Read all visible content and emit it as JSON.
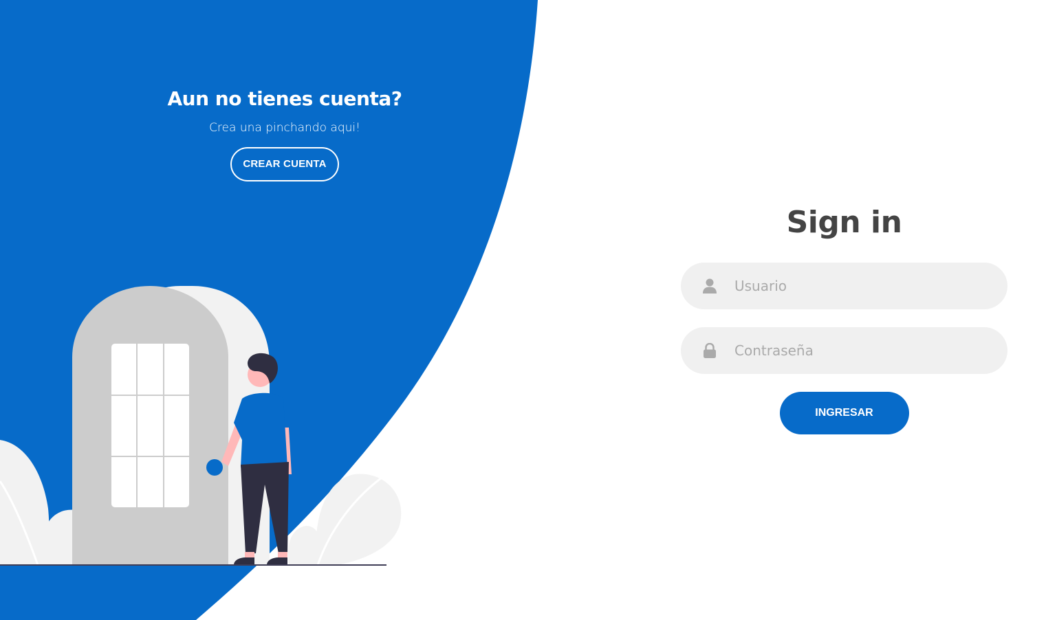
{
  "left_panel": {
    "title": "Aun no tienes cuenta?",
    "subtitle": "Crea una pinchando aqui!",
    "button_label": "CREAR CUENTA"
  },
  "signin_form": {
    "title": "Sign in",
    "username_placeholder": "Usuario",
    "password_placeholder": "Contraseña",
    "submit_label": "INGRESAR"
  },
  "colors": {
    "primary": "#076bc9",
    "field_bg": "#f0f0f0",
    "title_text": "#444444",
    "placeholder": "#aaaaaa"
  },
  "icons": {
    "username": "user-icon",
    "password": "lock-icon"
  }
}
